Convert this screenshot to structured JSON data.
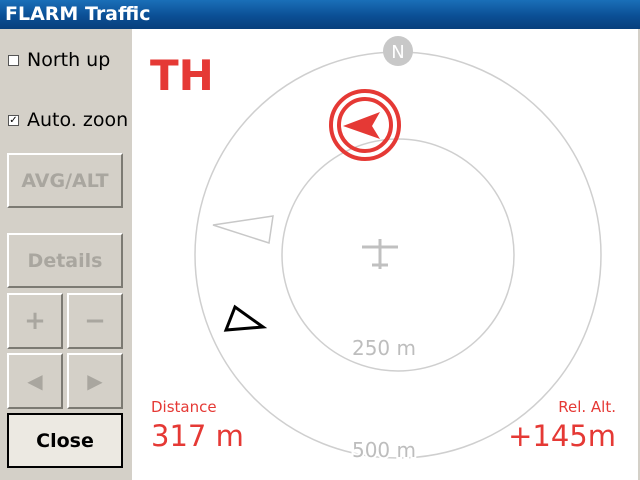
{
  "window": {
    "title": "FLARM Traffic"
  },
  "sidebar": {
    "north_up": {
      "label": "North up",
      "checked": false
    },
    "auto_zoom": {
      "label": "Auto. zoon",
      "checked": true
    },
    "avg_alt_button": "AVG/ALT",
    "details_button": "Details",
    "zoom_in_symbol": "+",
    "zoom_out_symbol": "−",
    "prev_symbol": "◀",
    "next_symbol": "▶",
    "close_button": "Close"
  },
  "radar": {
    "north_label": "N",
    "target_id": "TH",
    "inner_ring_label": "250 m",
    "outer_ring_label": "500 m",
    "distance": {
      "label": "Distance",
      "value": "317 m"
    },
    "rel_alt": {
      "label": "Rel. Alt.",
      "value": "+145m"
    }
  },
  "colors": {
    "warning": "#e53935",
    "ring": "#cfcfcf",
    "title_bar": "#0b4f95"
  }
}
